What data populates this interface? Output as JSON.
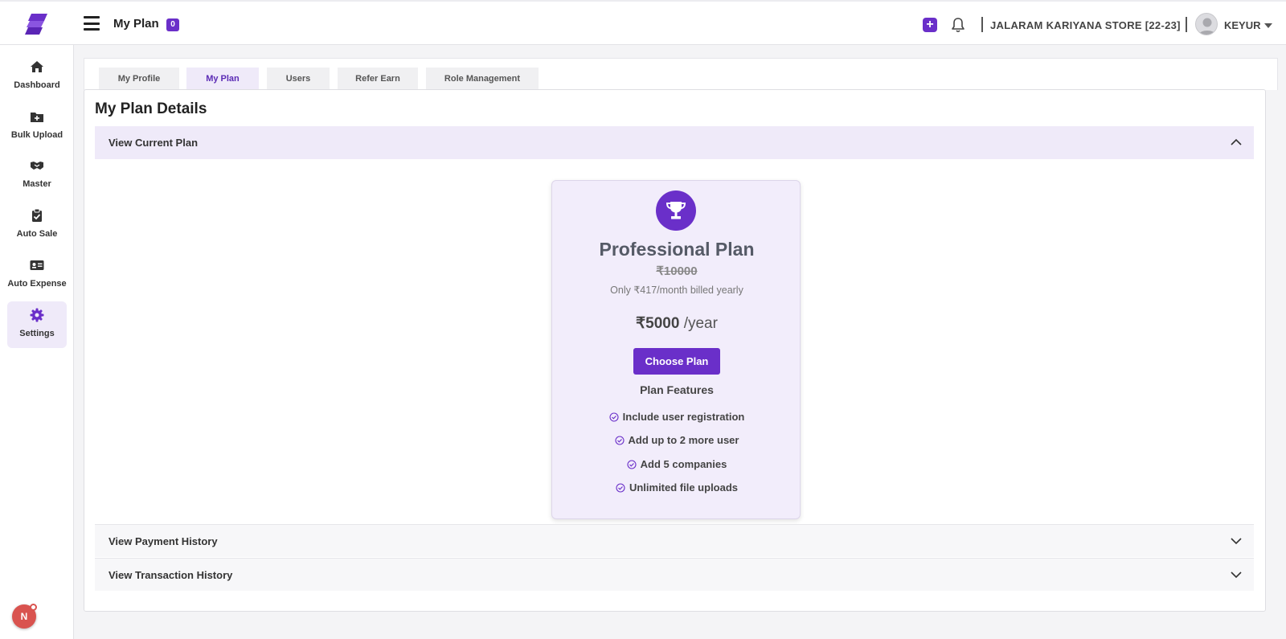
{
  "header": {
    "title": "My Plan",
    "badge": "0",
    "company": "JALARAM KARIYANA STORE [22-23]",
    "user": "KEYUR"
  },
  "sidebar": {
    "items": [
      {
        "label": "Dashboard",
        "icon": "home-icon"
      },
      {
        "label": "Bulk Upload",
        "icon": "folder-plus-icon"
      },
      {
        "label": "Master",
        "icon": "handshake-icon"
      },
      {
        "label": "Auto Sale",
        "icon": "clipboard-check-icon"
      },
      {
        "label": "Auto Expense",
        "icon": "id-card-icon"
      },
      {
        "label": "Settings",
        "icon": "gear-icon",
        "active": true
      }
    ],
    "floating_badge": "N"
  },
  "tabs": [
    {
      "label": "My Profile"
    },
    {
      "label": "My Plan",
      "active": true
    },
    {
      "label": "Users"
    },
    {
      "label": "Refer Earn"
    },
    {
      "label": "Role Management"
    }
  ],
  "main": {
    "title": "My Plan Details",
    "accordions": [
      {
        "label": "View Current Plan",
        "expanded": true
      },
      {
        "label": "View Payment History",
        "expanded": false
      },
      {
        "label": "View Transaction History",
        "expanded": false
      }
    ]
  },
  "plan": {
    "name": "Professional Plan",
    "original_price": "₹10000",
    "monthly_note": "Only ₹417/month billed yearly",
    "currency": "₹",
    "price": "5000",
    "period": " /year",
    "button": "Choose Plan",
    "features_title": "Plan Features",
    "features": [
      "Include user registration",
      "Add up to 2 more user",
      "Add 5 companies",
      "Unlimited file uploads"
    ]
  },
  "colors": {
    "accent": "#6a2fc9",
    "accent_light": "#efeaf9",
    "badge_red": "#d9534f"
  }
}
